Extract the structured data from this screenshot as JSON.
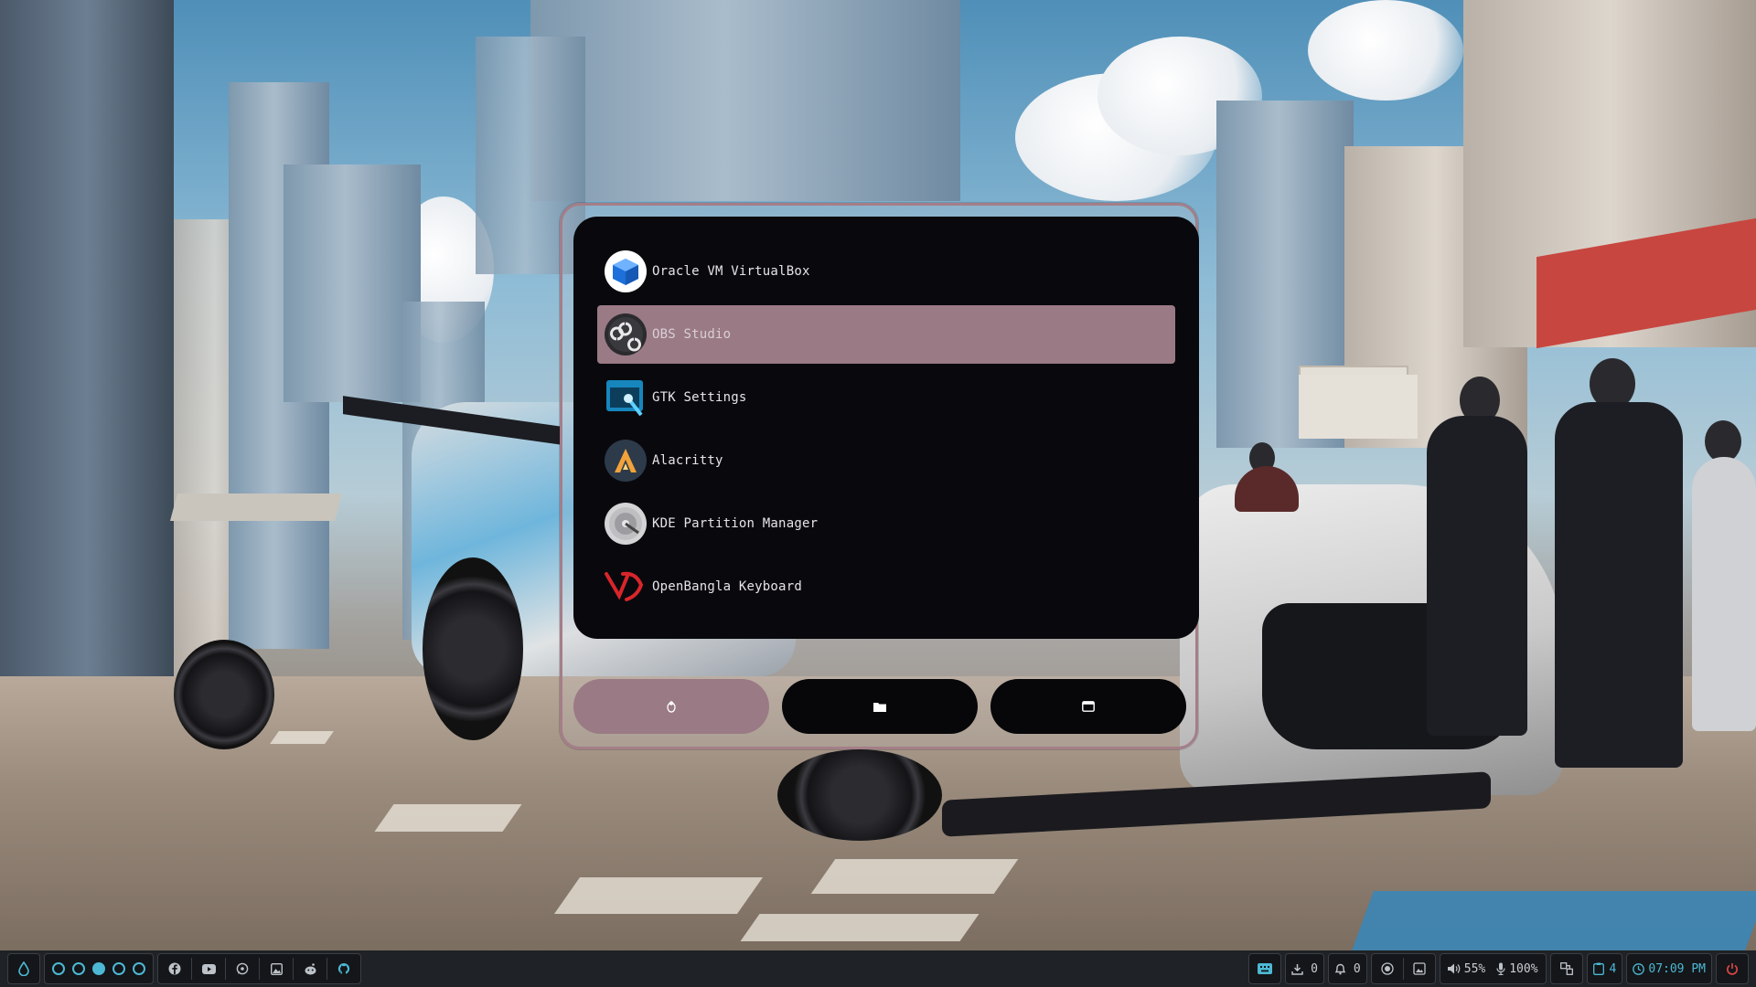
{
  "launcher": {
    "apps": [
      {
        "label": "Oracle VM VirtualBox",
        "icon": "virtualbox-icon",
        "selected": false
      },
      {
        "label": "OBS Studio",
        "icon": "obs-icon",
        "selected": true
      },
      {
        "label": "GTK Settings",
        "icon": "gtk-settings-icon",
        "selected": false
      },
      {
        "label": "Alacritty",
        "icon": "alacritty-icon",
        "selected": false
      },
      {
        "label": "KDE Partition Manager",
        "icon": "partition-manager-icon",
        "selected": false
      },
      {
        "label": "OpenBangla Keyboard",
        "icon": "openbangla-icon",
        "selected": false
      }
    ],
    "modes": [
      {
        "name": "apps",
        "icon": "linux-tux-icon",
        "active": true
      },
      {
        "name": "files",
        "icon": "folder-icon",
        "active": false
      },
      {
        "name": "windows",
        "icon": "window-icon",
        "active": false
      }
    ],
    "accent": "#9a7a85",
    "border": "#a47e88",
    "list_bg": "#09090d"
  },
  "taskbar": {
    "launcher_icon": "droplet-icon",
    "workspaces": [
      "empty",
      "empty",
      "active",
      "empty",
      "empty"
    ],
    "pinned": [
      "facebook-icon",
      "youtube-icon",
      "whatsapp-icon",
      "image-icon",
      "reddit-icon",
      "github-icon"
    ],
    "keyboard_icon": "keyboard-icon",
    "downloads": "0",
    "notifications": "0",
    "record_icon": "record-icon",
    "screenshot_icon": "screenshot-icon",
    "volume": "55%",
    "mic": "100%",
    "layout_icon": "layout-icon",
    "clipboard": "4",
    "clock": "07:09 PM",
    "power_icon": "power-icon",
    "accent": "#4db8d4",
    "power_color": "#e04848"
  }
}
